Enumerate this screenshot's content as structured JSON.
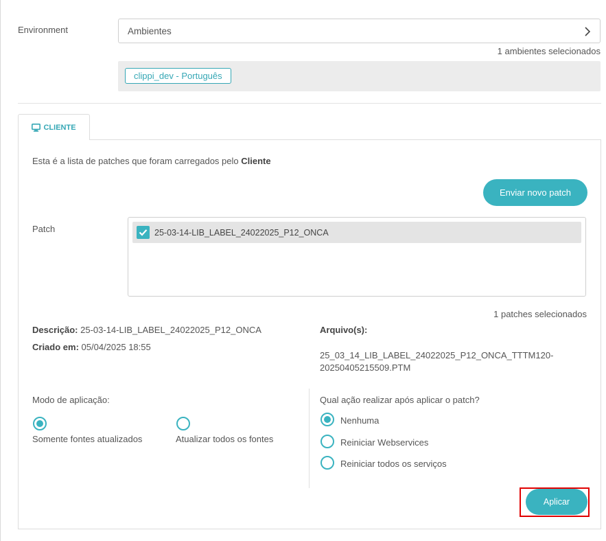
{
  "environment": {
    "label": "Environment",
    "select_value": "Ambientes",
    "selected_count": "1 ambientes selecionados",
    "tags": [
      "clippi_dev - Português"
    ]
  },
  "tab": {
    "label": "CLIENTE"
  },
  "intro": {
    "text": "Esta é a lista de patches que foram carregados pelo ",
    "bold": "Cliente"
  },
  "send_button": "Enviar novo patch",
  "patch": {
    "label": "Patch",
    "items": [
      "25-03-14-LIB_LABEL_24022025_P12_ONCA"
    ],
    "selected_count": "1 patches selecionados"
  },
  "details": {
    "descricao_label": "Descrição:",
    "descricao_value": "25-03-14-LIB_LABEL_24022025_P12_ONCA",
    "criado_label": "Criado em:",
    "criado_value": "05/04/2025 18:55",
    "arquivo_label": "Arquivo(s):",
    "arquivo_value": "25_03_14_LIB_LABEL_24022025_P12_ONCA_TTTM120-20250405215509.PTM"
  },
  "mode": {
    "title": "Modo de aplicação:",
    "options": [
      "Somente fontes atualizados",
      "Atualizar todos os fontes"
    ],
    "selected": 0
  },
  "post_action": {
    "title": "Qual ação realizar após aplicar o patch?",
    "options": [
      "Nenhuma",
      "Reiniciar Webservices",
      "Reiniciar todos os serviços"
    ],
    "selected": 0
  },
  "apply_button": "Aplicar",
  "colors": {
    "accent": "#3ab3c0",
    "highlight": "#e00000",
    "tag_bg": "#ececec"
  }
}
